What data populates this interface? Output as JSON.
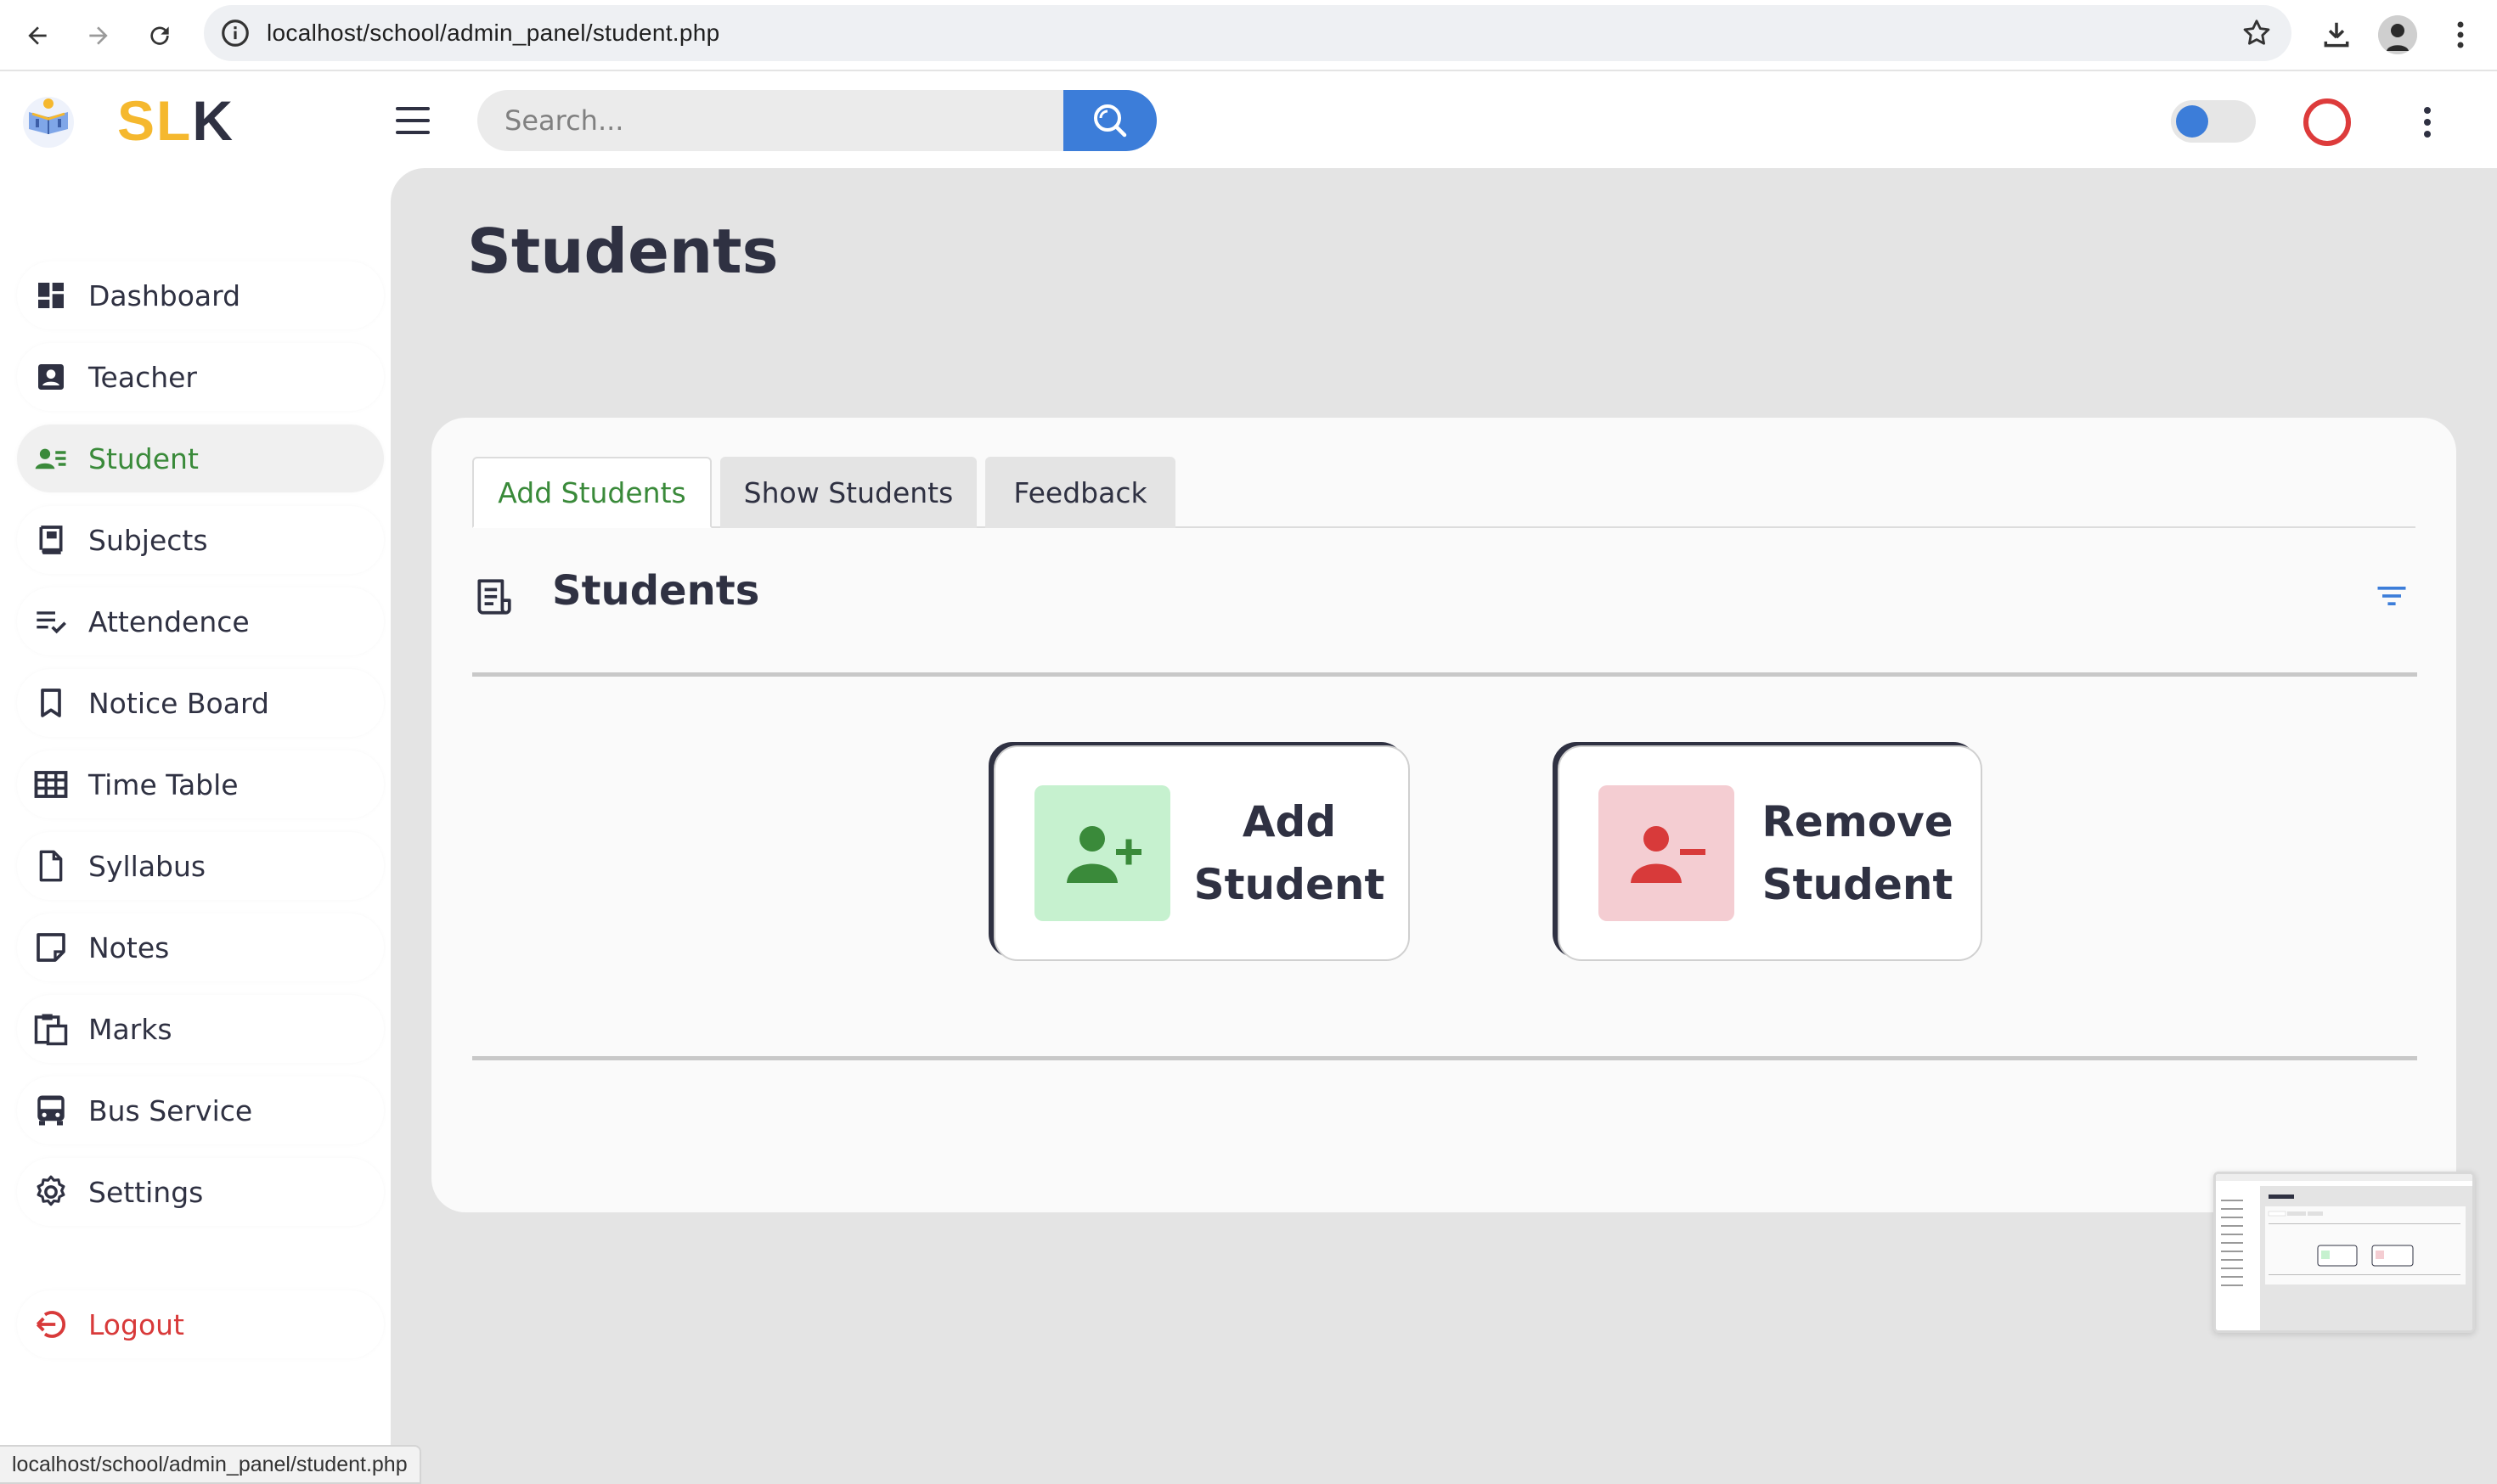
{
  "browser": {
    "url": "localhost/school/admin_panel/student.php",
    "status_url": "localhost/school/admin_panel/student.php"
  },
  "header": {
    "brand_part1": "SL",
    "brand_part2": "K",
    "search_placeholder": "Search...",
    "colors": {
      "accent": "#3c7dd9",
      "brand_yellow": "#f5b82e",
      "record_red": "#dd3b3b"
    }
  },
  "sidebar": {
    "items": [
      {
        "label": "Dashboard",
        "icon": "dashboard-icon"
      },
      {
        "label": "Teacher",
        "icon": "teacher-icon"
      },
      {
        "label": "Student",
        "icon": "student-icon",
        "active": true
      },
      {
        "label": "Subjects",
        "icon": "book-icon"
      },
      {
        "label": "Attendence",
        "icon": "checklist-icon"
      },
      {
        "label": "Notice Board",
        "icon": "bookmark-icon"
      },
      {
        "label": "Time Table",
        "icon": "table-icon"
      },
      {
        "label": "Syllabus",
        "icon": "document-icon"
      },
      {
        "label": "Notes",
        "icon": "sticky-note-icon"
      },
      {
        "label": "Marks",
        "icon": "clipboard-icon"
      },
      {
        "label": "Bus Service",
        "icon": "bus-icon"
      },
      {
        "label": "Settings",
        "icon": "gear-icon"
      }
    ],
    "logout": {
      "label": "Logout",
      "icon": "logout-icon"
    }
  },
  "main": {
    "title": "Students",
    "tabs": [
      {
        "label": "Add Students",
        "active": true
      },
      {
        "label": "Show Students"
      },
      {
        "label": "Feedback"
      }
    ],
    "section_title": "Students",
    "actions": {
      "add": {
        "line1": "Add",
        "line2": "Student",
        "icon": "add-user-icon",
        "color": "#3a8a3a"
      },
      "remove": {
        "line1": "Remove",
        "line2": "Student",
        "icon": "remove-user-icon",
        "color": "#d83a3a"
      }
    }
  }
}
